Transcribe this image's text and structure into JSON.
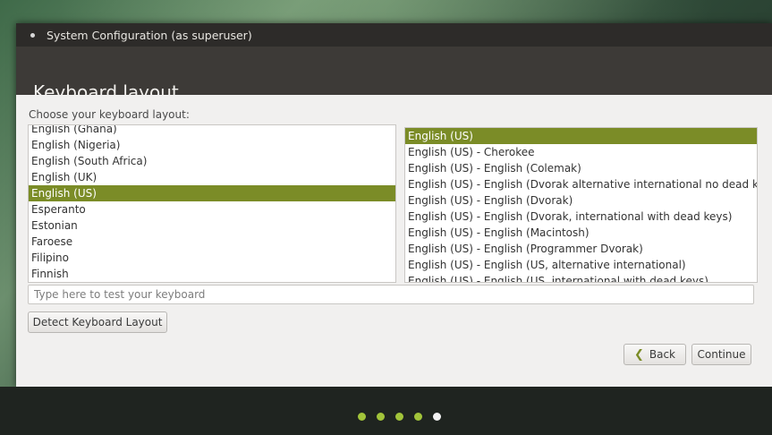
{
  "window": {
    "title": "System Configuration (as superuser)"
  },
  "page": {
    "title": "Keyboard layout"
  },
  "form": {
    "choose_label": "Choose your keyboard layout:",
    "test_placeholder": "Type here to test your keyboard",
    "test_value": "",
    "detect_button": "Detect Keyboard Layout",
    "back_button": "Back",
    "continue_button": "Continue"
  },
  "layouts": [
    "English (Ghana)",
    "English (Nigeria)",
    "English (South Africa)",
    "English (UK)",
    "English (US)",
    "Esperanto",
    "Estonian",
    "Faroese",
    "Filipino",
    "Finnish"
  ],
  "selected_layout": "English (US)",
  "variants": [
    "English (US)",
    "English (US) - Cherokee",
    "English (US) - English (Colemak)",
    "English (US) - English (Dvorak alternative international no dead keys)",
    "English (US) - English (Dvorak)",
    "English (US) - English (Dvorak, international with dead keys)",
    "English (US) - English (Macintosh)",
    "English (US) - English (Programmer Dvorak)",
    "English (US) - English (US, alternative international)",
    "English (US) - English (US, international with dead keys)"
  ],
  "selected_variant": "English (US)",
  "progress": {
    "total_steps": 5,
    "current_step": 5
  },
  "colors": {
    "selection": "#7b8c27",
    "progress_dot": "#a2c43a",
    "progress_dot_active": "#f2f2f2",
    "titlebar": "#2d2b29",
    "content_bg": "#f1f0ef"
  }
}
